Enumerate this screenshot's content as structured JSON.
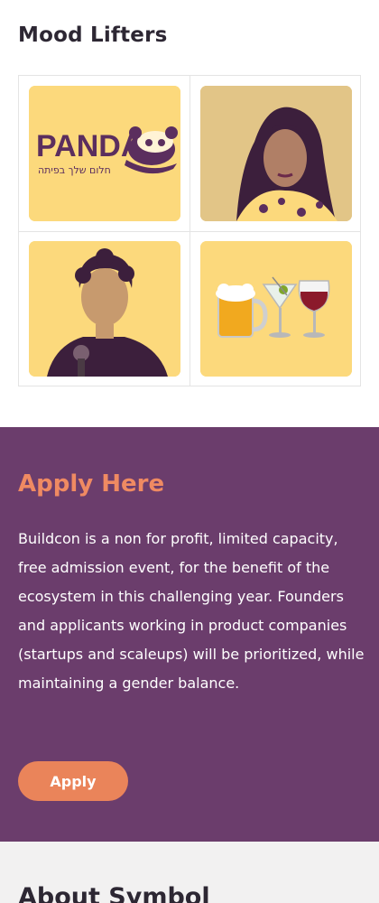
{
  "mood": {
    "title": "Mood Lifters",
    "tiles": [
      {
        "name": "panda-logo",
        "wordmark": "PANDA",
        "subtitle": "חלום שלך בפיתה"
      },
      {
        "name": "woman-portrait"
      },
      {
        "name": "man-with-microphone-portrait"
      },
      {
        "name": "drinks-emoji"
      }
    ]
  },
  "apply": {
    "title": "Apply Here",
    "body": "Buildcon is a non for profit, limited capacity, free admission event, for the benefit of the ecosystem in this challenging year. Founders and applicants working in product companies (startups and scaleups) will be prioritized, while maintaining a gender balance.",
    "button_label": "Apply"
  },
  "about": {
    "title": "About Symbol"
  },
  "colors": {
    "tile_bg": "#fcd97c",
    "duotone_dark": "#5b2e5e",
    "apply_bg": "#6b3d6c",
    "accent": "#ef8a62",
    "about_bg": "#f2f1f1"
  }
}
